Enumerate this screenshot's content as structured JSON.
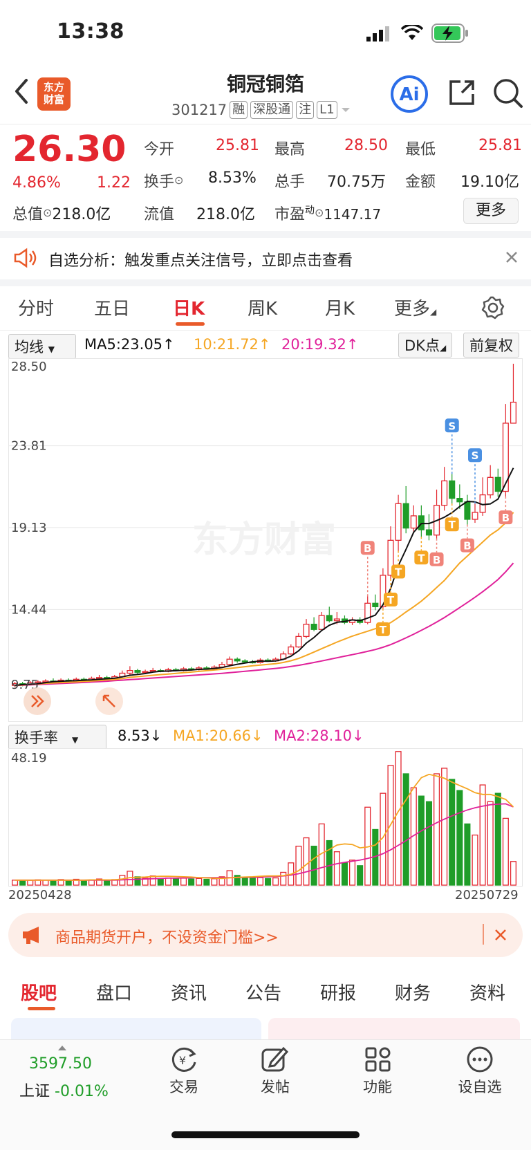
{
  "status": {
    "time": "13:38"
  },
  "header": {
    "title": "铜冠铜箔",
    "code": "301217",
    "tags": [
      "融",
      "深股通",
      "注",
      "L1"
    ],
    "logo_text": "东方财富"
  },
  "quote": {
    "price": "26.30",
    "change_pct": "4.86%",
    "change": "1.22",
    "open_label": "今开",
    "open": "25.81",
    "high_label": "最高",
    "high": "28.50",
    "low_label": "最低",
    "low": "25.81",
    "turnover_label": "换手",
    "turnover": "8.53%",
    "volume_label": "总手",
    "volume": "70.75万",
    "amount_label": "金额",
    "amount": "19.10亿",
    "mcap_label": "总值",
    "mcap": "218.0亿",
    "float_label": "流值",
    "float": "218.0亿",
    "pe_label": "市盈",
    "pe_sup": "动",
    "pe": "1147.17",
    "more": "更多"
  },
  "notice": {
    "text": "自选分析：触发重点关注信号，立即点击查看"
  },
  "period_tabs": [
    "分时",
    "五日",
    "日K",
    "周K",
    "月K",
    "更多"
  ],
  "main_indicator": {
    "selector": "均线",
    "ma5": "MA5:23.05",
    "ma10": "10:21.72",
    "ma20": "20:19.32",
    "dk_button": "DK点",
    "fq_button": "前复权"
  },
  "price_axis": [
    "28.50",
    "23.81",
    "19.13",
    "14.44",
    "9.75"
  ],
  "watermark": "东方财富",
  "sub_indicator": {
    "selector": "换手率",
    "value": "8.53",
    "ma1": "MA1:20.66",
    "ma2": "MA2:28.10",
    "axis_max": "48.19",
    "date_start": "20250428",
    "date_end": "20250729"
  },
  "chart_data": {
    "type": "candlestick",
    "y_range": [
      9.75,
      28.5
    ],
    "turnover_max": 48.19,
    "x_start": "20250428",
    "x_end": "20250729",
    "candles": [
      [
        10.1,
        10.2,
        10.3,
        10.0,
        1.8
      ],
      [
        10.2,
        10.15,
        10.3,
        10.05,
        1.6
      ],
      [
        10.15,
        10.25,
        10.35,
        10.1,
        1.7
      ],
      [
        10.25,
        10.3,
        10.4,
        10.15,
        1.9
      ],
      [
        10.3,
        10.35,
        10.45,
        10.2,
        1.8
      ],
      [
        10.35,
        10.3,
        10.5,
        10.25,
        1.6
      ],
      [
        10.3,
        10.4,
        10.5,
        10.25,
        2.0
      ],
      [
        10.4,
        10.35,
        10.5,
        10.3,
        1.7
      ],
      [
        10.35,
        10.45,
        10.55,
        10.3,
        2.1
      ],
      [
        10.45,
        10.4,
        10.55,
        10.35,
        1.8
      ],
      [
        10.4,
        10.5,
        10.6,
        10.35,
        1.9
      ],
      [
        10.5,
        10.55,
        10.7,
        10.45,
        2.2
      ],
      [
        10.55,
        10.5,
        10.65,
        10.45,
        1.8
      ],
      [
        10.5,
        10.6,
        10.7,
        10.45,
        2.0
      ],
      [
        10.6,
        10.8,
        10.95,
        10.55,
        3.5
      ],
      [
        10.8,
        10.95,
        11.2,
        10.7,
        5.0
      ],
      [
        10.95,
        10.85,
        11.05,
        10.75,
        3.0
      ],
      [
        10.85,
        10.9,
        11.0,
        10.8,
        2.5
      ],
      [
        10.9,
        10.95,
        11.1,
        10.85,
        3.3
      ],
      [
        10.95,
        10.9,
        11.05,
        10.85,
        2.4
      ],
      [
        10.9,
        11.0,
        11.1,
        10.85,
        2.6
      ],
      [
        11.0,
        10.95,
        11.1,
        10.9,
        2.3
      ],
      [
        10.95,
        11.05,
        11.15,
        10.9,
        2.5
      ],
      [
        11.05,
        11.0,
        11.15,
        10.95,
        2.2
      ],
      [
        11.0,
        11.1,
        11.2,
        10.95,
        2.4
      ],
      [
        11.1,
        11.05,
        11.2,
        11.0,
        2.1
      ],
      [
        11.05,
        11.15,
        11.25,
        11.0,
        2.3
      ],
      [
        11.15,
        11.3,
        11.45,
        11.1,
        3.0
      ],
      [
        11.3,
        11.6,
        11.75,
        11.25,
        5.2
      ],
      [
        11.6,
        11.5,
        11.7,
        11.4,
        3.5
      ],
      [
        11.5,
        11.45,
        11.6,
        11.4,
        2.8
      ],
      [
        11.45,
        11.4,
        11.55,
        11.35,
        2.5
      ],
      [
        11.4,
        11.55,
        11.65,
        11.35,
        2.7
      ],
      [
        11.55,
        11.5,
        11.65,
        11.45,
        2.4
      ],
      [
        11.5,
        11.6,
        11.7,
        11.45,
        2.6
      ],
      [
        11.6,
        11.9,
        12.05,
        11.55,
        4.6
      ],
      [
        11.9,
        12.3,
        12.45,
        11.85,
        8.0
      ],
      [
        12.3,
        12.9,
        13.1,
        12.25,
        14.0
      ],
      [
        12.9,
        13.6,
        13.9,
        12.8,
        17.0
      ],
      [
        13.6,
        13.3,
        14.0,
        13.2,
        14.0
      ],
      [
        13.3,
        14.1,
        14.3,
        13.2,
        22.0
      ],
      [
        14.1,
        13.8,
        14.6,
        13.7,
        16.0
      ],
      [
        13.8,
        13.9,
        14.3,
        13.6,
        12.0
      ],
      [
        13.9,
        13.7,
        14.1,
        13.6,
        8.0
      ],
      [
        13.7,
        13.85,
        14.0,
        13.55,
        9.0
      ],
      [
        13.85,
        13.7,
        14.0,
        13.6,
        7.0
      ],
      [
        13.7,
        14.8,
        15.2,
        13.6,
        28.0
      ],
      [
        14.8,
        14.6,
        15.3,
        14.4,
        20.0
      ],
      [
        14.6,
        16.4,
        16.8,
        14.5,
        33.0
      ],
      [
        16.4,
        18.4,
        19.2,
        16.2,
        43.0
      ],
      [
        18.4,
        20.5,
        21.0,
        17.8,
        48.0
      ],
      [
        20.5,
        19.1,
        21.5,
        18.8,
        40.0
      ],
      [
        19.1,
        19.8,
        20.4,
        18.8,
        35.0
      ],
      [
        19.8,
        19.0,
        20.4,
        18.6,
        32.0
      ],
      [
        19.0,
        18.7,
        19.9,
        18.4,
        30.0
      ],
      [
        18.7,
        20.4,
        21.3,
        18.5,
        40.0
      ],
      [
        20.4,
        21.8,
        22.6,
        20.1,
        42.0
      ],
      [
        21.8,
        20.8,
        22.2,
        20.5,
        38.0
      ],
      [
        20.8,
        20.6,
        21.6,
        20.2,
        34.0
      ],
      [
        20.6,
        19.6,
        21.0,
        19.3,
        22.0
      ],
      [
        19.6,
        20.0,
        20.5,
        19.4,
        18.0
      ],
      [
        20.0,
        21.0,
        22.0,
        19.8,
        36.0
      ],
      [
        21.0,
        22.0,
        22.7,
        20.8,
        30.0
      ],
      [
        22.0,
        21.2,
        22.5,
        20.9,
        33.0
      ],
      [
        21.2,
        25.1,
        26.2,
        20.9,
        24.0
      ],
      [
        25.1,
        26.3,
        28.5,
        25.81,
        8.5
      ]
    ],
    "ma5": [
      10.1,
      10.15,
      10.17,
      10.2,
      10.26,
      10.31,
      10.34,
      10.36,
      10.37,
      10.4,
      10.42,
      10.45,
      10.48,
      10.51,
      10.59,
      10.68,
      10.73,
      10.78,
      10.86,
      10.91,
      10.92,
      10.94,
      10.97,
      10.98,
      11.02,
      11.03,
      11.07,
      11.12,
      11.22,
      11.31,
      11.38,
      11.45,
      11.49,
      11.48,
      11.5,
      11.59,
      11.77,
      12.08,
      12.52,
      12.84,
      13.24,
      13.54,
      13.71,
      13.76,
      13.85,
      13.8,
      13.95,
      14.12,
      14.71,
      15.64,
      16.95,
      17.88,
      18.86,
      19.36,
      19.36,
      19.53,
      19.72,
      19.98,
      20.33,
      20.63,
      20.6,
      20.44,
      20.48,
      20.76,
      21.66,
      22.54
    ],
    "ma10": [
      10.1,
      10.13,
      10.16,
      10.18,
      10.22,
      10.24,
      10.26,
      10.28,
      10.3,
      10.33,
      10.35,
      10.38,
      10.41,
      10.44,
      10.49,
      10.56,
      10.6,
      10.64,
      10.68,
      10.72,
      10.75,
      10.79,
      10.83,
      10.86,
      10.9,
      10.94,
      10.98,
      11.02,
      11.07,
      11.12,
      11.17,
      11.22,
      11.26,
      11.3,
      11.34,
      11.41,
      11.51,
      11.64,
      11.82,
      12.01,
      12.2,
      12.39,
      12.58,
      12.75,
      12.92,
      13.06,
      13.2,
      13.34,
      13.5,
      13.69,
      13.98,
      14.3,
      14.6,
      14.92,
      15.3,
      15.7,
      16.1,
      16.6,
      17.1,
      17.5,
      17.9,
      18.3,
      18.7,
      19.0,
      19.4,
      20.0
    ],
    "ma20": [
      10.1,
      10.11,
      10.13,
      10.15,
      10.17,
      10.19,
      10.21,
      10.23,
      10.25,
      10.27,
      10.29,
      10.31,
      10.34,
      10.37,
      10.4,
      10.43,
      10.46,
      10.49,
      10.52,
      10.55,
      10.58,
      10.61,
      10.64,
      10.67,
      10.7,
      10.73,
      10.76,
      10.79,
      10.83,
      10.87,
      10.91,
      10.95,
      10.99,
      11.03,
      11.07,
      11.12,
      11.18,
      11.25,
      11.33,
      11.41,
      11.5,
      11.59,
      11.68,
      11.77,
      11.86,
      11.95,
      12.05,
      12.15,
      12.28,
      12.43,
      12.62,
      12.82,
      13.03,
      13.25,
      13.48,
      13.72,
      13.98,
      14.26,
      14.55,
      14.84,
      15.14,
      15.46,
      15.8,
      16.16,
      16.6,
      17.1
    ],
    "turnover_ma1": [
      1.8,
      1.8,
      1.8,
      1.8,
      1.8,
      1.8,
      1.8,
      1.8,
      1.8,
      1.8,
      1.9,
      1.9,
      1.9,
      1.9,
      2.2,
      2.7,
      2.8,
      2.9,
      3.1,
      3.2,
      3.2,
      3.1,
      3.0,
      2.9,
      2.7,
      2.6,
      2.5,
      2.4,
      2.6,
      2.8,
      2.9,
      3.0,
      3.2,
      3.3,
      3.3,
      3.4,
      3.9,
      5.2,
      7.4,
      9.6,
      11.4,
      12.8,
      14.4,
      14.8,
      14.6,
      13.4,
      13.7,
      14.4,
      17.1,
      21.7,
      26.5,
      30.6,
      35.0,
      38.6,
      39.8,
      39.2,
      38.4,
      37.0,
      35.8,
      34.6,
      33.2,
      32.6,
      32.6,
      31.8,
      30.8,
      28.1
    ],
    "turnover_ma2": [
      1.8,
      1.8,
      1.8,
      1.8,
      1.8,
      1.8,
      1.8,
      1.8,
      1.8,
      1.8,
      1.8,
      1.8,
      1.8,
      1.8,
      1.9,
      2.0,
      2.1,
      2.2,
      2.3,
      2.4,
      2.5,
      2.5,
      2.6,
      2.6,
      2.7,
      2.7,
      2.7,
      2.7,
      2.7,
      2.7,
      2.8,
      2.8,
      2.9,
      3.0,
      3.1,
      3.3,
      3.6,
      4.1,
      4.8,
      5.5,
      6.3,
      7.0,
      7.7,
      8.2,
      8.6,
      9.0,
      9.6,
      10.3,
      11.3,
      12.7,
      14.3,
      16.0,
      17.8,
      19.5,
      21.0,
      22.4,
      23.7,
      24.9,
      26.0,
      27.0,
      27.8,
      28.4,
      28.9,
      29.1,
      29.2,
      28.1
    ],
    "markers": [
      {
        "i": 46,
        "label": "B",
        "pos": "above"
      },
      {
        "i": 48,
        "label": "T",
        "pos": "below"
      },
      {
        "i": 49,
        "label": "T",
        "pos": "below"
      },
      {
        "i": 50,
        "label": "T",
        "pos": "below"
      },
      {
        "i": 53,
        "label": "T",
        "pos": "below"
      },
      {
        "i": 55,
        "label": "B",
        "pos": "below"
      },
      {
        "i": 57,
        "label": "T",
        "pos": "below"
      },
      {
        "i": 57,
        "label": "S",
        "pos": "above"
      },
      {
        "i": 59,
        "label": "B",
        "pos": "below"
      },
      {
        "i": 60,
        "label": "S",
        "pos": "above"
      },
      {
        "i": 64,
        "label": "B",
        "pos": "below"
      }
    ]
  },
  "promo": {
    "text": "商品期货开户，不设资金门槛>>"
  },
  "content_tabs": [
    "股吧",
    "盘口",
    "资讯",
    "公告",
    "研报",
    "财务",
    "资料"
  ],
  "bottom_nav": {
    "index_value": "3597.50",
    "index_name": "上证",
    "index_change": "-0.01%",
    "items": [
      "交易",
      "发帖",
      "功能",
      "设自选"
    ]
  },
  "colors": {
    "up": "#e3262f",
    "down": "#1f9d28",
    "brand": "#e95a2a",
    "ma5": "#111111",
    "ma10": "#f5a623",
    "ma20": "#e0219a"
  }
}
